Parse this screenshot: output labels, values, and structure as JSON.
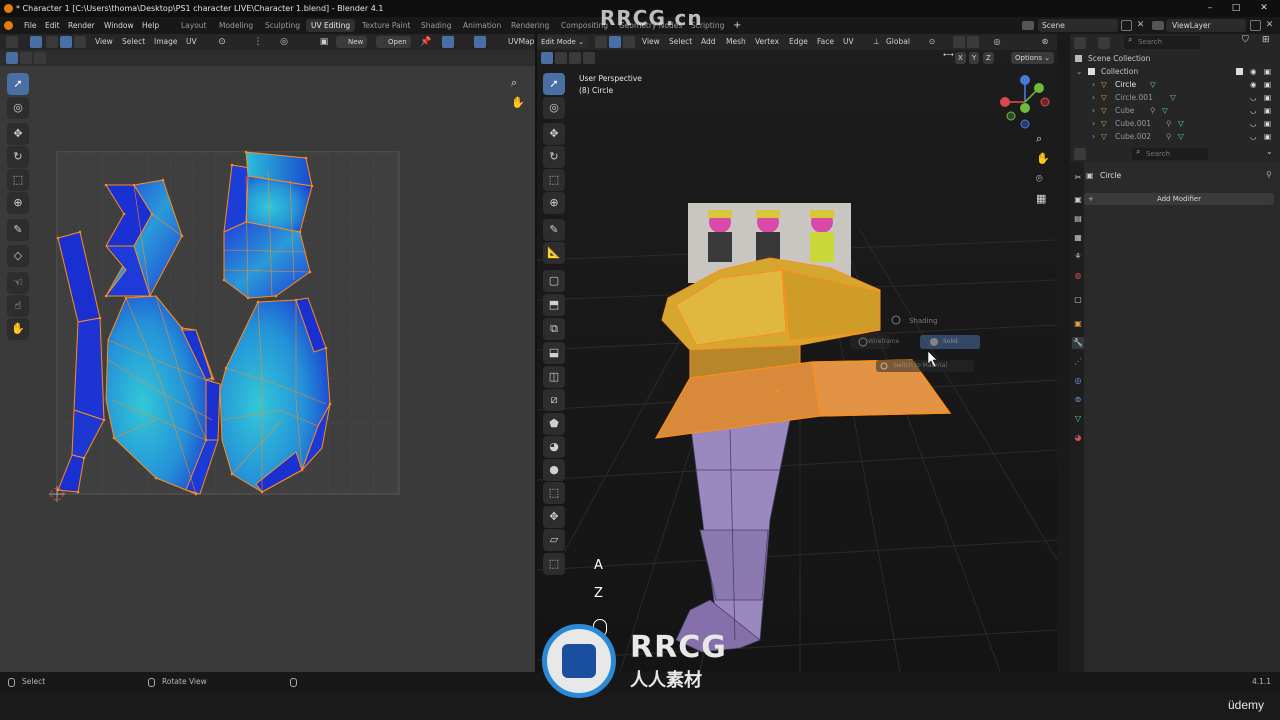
{
  "window": {
    "title": "* Character 1 [C:\\Users\\thoma\\Desktop\\PS1 character LIVE\\Character 1.blend] - Blender 4.1",
    "controls": [
      "–",
      "□",
      "✕"
    ]
  },
  "watermark": "RRCG.cn",
  "menu": [
    "File",
    "Edit",
    "Render",
    "Window",
    "Help"
  ],
  "workspaces": [
    "Layout",
    "Modeling",
    "Sculpting",
    "UV Editing",
    "Texture Paint",
    "Shading",
    "Animation",
    "Rendering",
    "Compositing",
    "Geometry Nodes",
    "Scripting"
  ],
  "active_workspace": "UV Editing",
  "scene": {
    "name": "Scene",
    "view_layer": "ViewLayer"
  },
  "uv_editor": {
    "header_menus": [
      "View",
      "Select",
      "Image",
      "UV"
    ],
    "new_label": "New",
    "open_label": "Open",
    "uvmap_label": "UVMap"
  },
  "viewport": {
    "mode": "Edit Mode",
    "header_menus": [
      "View",
      "Select",
      "Add",
      "Mesh",
      "Vertex",
      "Edge",
      "Face",
      "UV"
    ],
    "orientation": "Global",
    "axes": [
      "X",
      "Y",
      "Z"
    ],
    "options_label": "Options",
    "perspective": "User Perspective",
    "object_label": "(8) Circle",
    "pie_menu": {
      "shading": "Shading",
      "item1": "Wireframe",
      "item2": "Solid",
      "item3": "Switch to Material"
    },
    "keys": [
      "A",
      "Z"
    ]
  },
  "outliner": {
    "search_placeholder": "Search",
    "items": [
      {
        "label": "Scene Collection",
        "type": "scene"
      },
      {
        "label": "Collection",
        "type": "collection"
      },
      {
        "label": "Circle",
        "type": "mesh"
      },
      {
        "label": "Circle.001",
        "type": "mesh"
      },
      {
        "label": "Cube",
        "type": "mesh"
      },
      {
        "label": "Cube.001",
        "type": "mesh"
      },
      {
        "label": "Cube.002",
        "type": "mesh"
      }
    ]
  },
  "properties": {
    "search_placeholder": "Search",
    "object_name": "Circle",
    "add_modifier_label": "Add Modifier"
  },
  "statusbar": {
    "left": "Select",
    "middle": "Rotate View",
    "version": "4.1.1"
  },
  "branding": {
    "logo_text": "RRCG",
    "logo_sub": "人人素材",
    "udemy": "üdemy"
  },
  "colors": {
    "accent": "#4a6fa5",
    "selection": "#ff8c1a",
    "uv_dark": "#1a2fd0",
    "uv_light": "#2ab8d8",
    "mesh_yellow": "#d4a830",
    "mesh_orange": "#d88a3a",
    "mesh_purple": "#9a88c0"
  }
}
